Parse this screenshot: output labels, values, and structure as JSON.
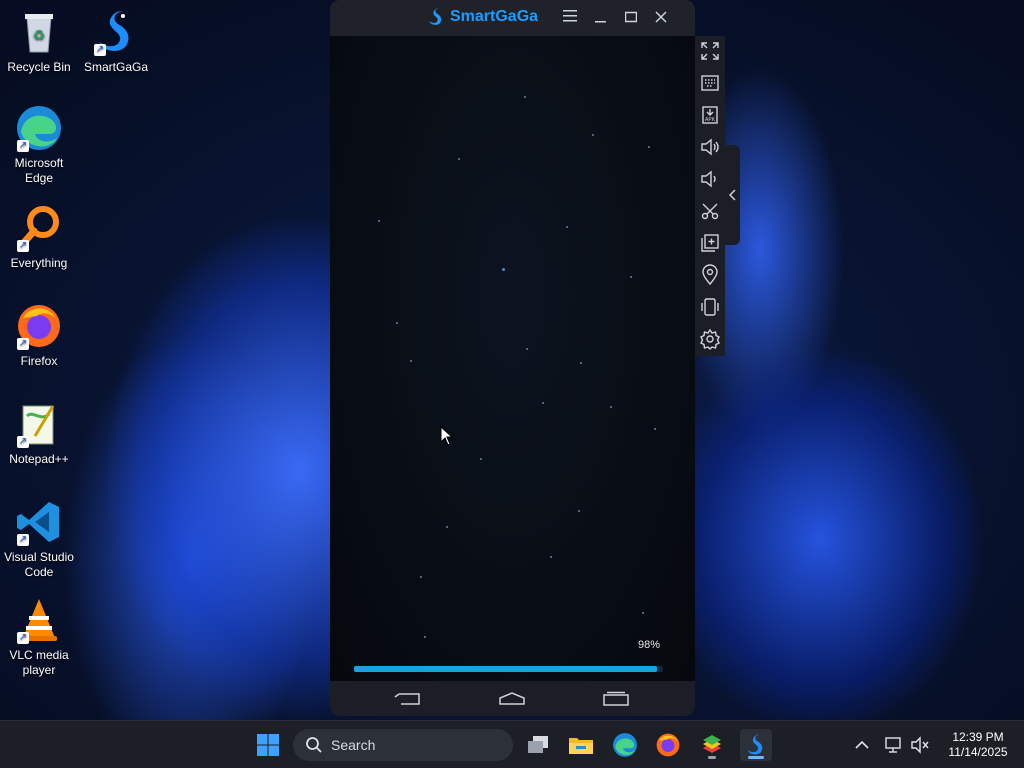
{
  "desktop": {
    "icons": [
      {
        "label": "Recycle Bin",
        "icon": "recycle-bin-icon"
      },
      {
        "label": "SmartGaGa",
        "icon": "smartgaga-icon"
      },
      {
        "label": "Microsoft Edge",
        "icon": "edge-icon"
      },
      {
        "label": "Everything",
        "icon": "everything-icon"
      },
      {
        "label": "Firefox",
        "icon": "firefox-icon"
      },
      {
        "label": "Notepad++",
        "icon": "notepadpp-icon"
      },
      {
        "label": "Visual Studio Code",
        "icon": "vscode-icon"
      },
      {
        "label": "VLC media player",
        "icon": "vlc-icon"
      }
    ]
  },
  "emulator": {
    "title": "SmartGaGa",
    "progress_label": "98%",
    "progress": 0.98,
    "toolbar": [
      "fullscreen-icon",
      "keyboard-icon",
      "apk-install-icon",
      "volume-up-icon",
      "volume-down-icon",
      "screenshot-scissors-icon",
      "multi-instance-icon",
      "location-icon",
      "shake-icon",
      "settings-icon"
    ],
    "nav": [
      "back-icon",
      "home-icon",
      "recents-icon"
    ]
  },
  "taskbar": {
    "search_label": "Search",
    "time": "12:39 PM",
    "date": "11/14/2025"
  },
  "colors": {
    "accent": "#1e9bff",
    "progress": "#1aa0e6",
    "taskbar": "#1c1f26"
  }
}
